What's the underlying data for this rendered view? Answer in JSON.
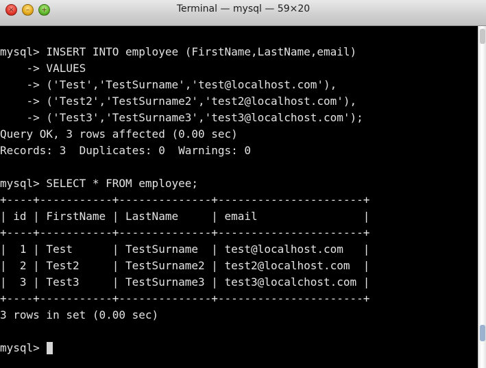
{
  "window": {
    "title": "Terminal — mysql — 59×20",
    "close_glyph": "×",
    "minimize_glyph": "–",
    "maximize_glyph": "+"
  },
  "terminal": {
    "lines": [
      "",
      "mysql> INSERT INTO employee (FirstName,LastName,email)",
      "    -> VALUES",
      "    -> ('Test','TestSurname','test@localhost.com'),",
      "    -> ('Test2','TestSurname2','test2@localhost.com'),",
      "    -> ('Test3','TestSurname3','test3@localchost.com');",
      "Query OK, 3 rows affected (0.00 sec)",
      "Records: 3  Duplicates: 0  Warnings: 0",
      "",
      "mysql> SELECT * FROM employee;",
      "+----+-----------+--------------+----------------------+",
      "| id | FirstName | LastName     | email                |",
      "+----+-----------+--------------+----------------------+",
      "|  1 | Test      | TestSurname  | test@localhost.com   |",
      "|  2 | Test2     | TestSurname2 | test2@localhost.com  |",
      "|  3 | Test3     | TestSurname3 | test3@localchost.com |",
      "+----+-----------+--------------+----------------------+",
      "3 rows in set (0.00 sec)",
      "",
      "mysql> "
    ]
  },
  "colors": {
    "terminal_background": "#000000",
    "terminal_text": "#e3e3e3",
    "cursor": "#d6d6d6"
  }
}
